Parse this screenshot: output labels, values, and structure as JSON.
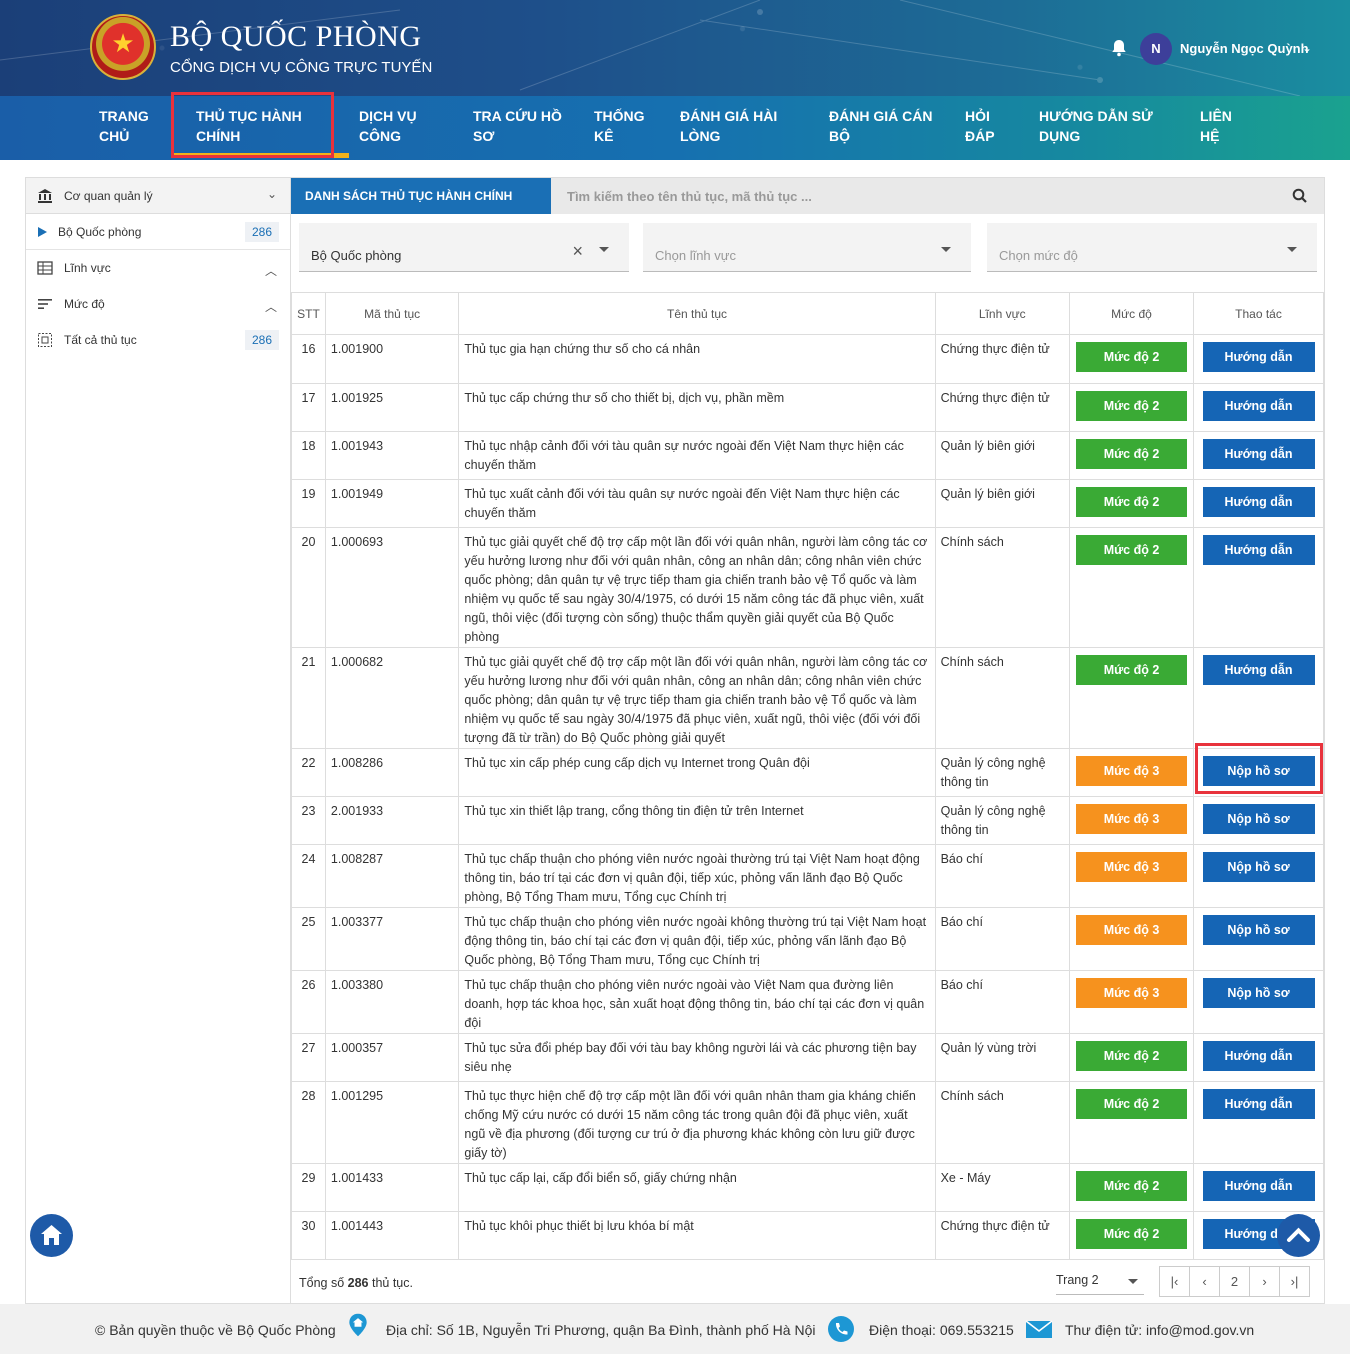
{
  "header": {
    "title": "BỘ QUỐC PHÒNG",
    "subtitle": "CỔNG DỊCH VỤ CÔNG TRỰC TUYẾN",
    "user_initial": "N",
    "user_name": "Nguyễn Ngọc Quỳnh"
  },
  "nav": [
    {
      "line1": "TRANG",
      "line2": "CHỦ"
    },
    {
      "line1": "THỦ TỤC HÀNH",
      "line2": "CHÍNH"
    },
    {
      "line1": "DỊCH VỤ",
      "line2": "CÔNG"
    },
    {
      "line1": "TRA CỨU HỒ",
      "line2": "SƠ"
    },
    {
      "line1": "THỐNG",
      "line2": "KÊ"
    },
    {
      "line1": "ĐÁNH GIÁ HÀI",
      "line2": "LÒNG"
    },
    {
      "line1": "ĐÁNH GIÁ CÁN",
      "line2": "BỘ"
    },
    {
      "line1": "HỎI",
      "line2": "ĐÁP"
    },
    {
      "line1": "HƯỚNG DẪN SỬ",
      "line2": "DỤNG"
    },
    {
      "line1": "LIÊN",
      "line2": "HỆ"
    }
  ],
  "sidebar": {
    "agency_header": "Cơ quan quản lý",
    "agency_item": "Bộ Quốc phòng",
    "agency_count": "286",
    "field_header": "Lĩnh vực",
    "level_header": "Mức độ",
    "all_label": "Tất cả thủ tục",
    "all_count": "286"
  },
  "main": {
    "tab_label": "DANH SÁCH THỦ TỤC HÀNH CHÍNH",
    "search_placeholder": "Tìm kiếm theo tên thủ tục, mã thủ tục ...",
    "filter_agency": "Bộ Quốc phòng",
    "filter_field_placeholder": "Chọn lĩnh vực",
    "filter_level_placeholder": "Chọn mức độ"
  },
  "table": {
    "headers": [
      "STT",
      "Mã thủ tục",
      "Tên thủ tục",
      "Lĩnh vực",
      "Mức độ",
      "Thao tác"
    ],
    "rows": [
      {
        "stt": "16",
        "code": "1.001900",
        "name": "Thủ tục gia hạn chứng thư số cho cá nhân",
        "field": "Chứng thực điện tử",
        "level": "Mức độ 2",
        "level_num": 2,
        "action": "Hướng dẫn"
      },
      {
        "stt": "17",
        "code": "1.001925",
        "name": "Thủ tục cấp chứng thư số cho thiết bị, dịch vụ, phần mềm",
        "field": "Chứng thực điện tử",
        "level": "Mức độ 2",
        "level_num": 2,
        "action": "Hướng dẫn"
      },
      {
        "stt": "18",
        "code": "1.001943",
        "name": "Thủ tục nhập cảnh đối với tàu quân sự nước ngoài đến Việt Nam thực hiện các chuyến thăm",
        "field": "Quản lý biên giới",
        "level": "Mức độ 2",
        "level_num": 2,
        "action": "Hướng dẫn"
      },
      {
        "stt": "19",
        "code": "1.001949",
        "name": "Thủ tục xuất cảnh đối với tàu quân sự nước ngoài đến Việt Nam thực hiện các chuyến thăm",
        "field": "Quản lý biên giới",
        "level": "Mức độ 2",
        "level_num": 2,
        "action": "Hướng dẫn"
      },
      {
        "stt": "20",
        "code": "1.000693",
        "name": "Thủ tục giải quyết chế độ trợ cấp một lần đối với quân nhân, người làm công tác cơ yếu hưởng lương như đối với quân nhân, công an nhân dân; công nhân viên chức quốc phòng; dân quân tự vệ trực tiếp tham gia chiến tranh bảo vệ Tổ quốc và làm nhiệm vụ quốc tế sau ngày 30/4/1975, có dưới 15 năm công tác đã phục viên, xuất ngũ, thôi việc (đối tượng còn sống) thuộc thẩm quyền giải quyết của Bộ Quốc phòng",
        "field": "Chính sách",
        "level": "Mức độ 2",
        "level_num": 2,
        "action": "Hướng dẫn"
      },
      {
        "stt": "21",
        "code": "1.000682",
        "name": "Thủ tục giải quyết chế độ trợ cấp một lần đối với quân nhân, người làm công tác cơ yếu hưởng lương như đối với quân nhân, công an nhân dân; công nhân viên chức quốc phòng; dân quân tự vệ trực tiếp tham gia chiến tranh bảo vệ Tổ quốc và làm nhiệm vụ quốc tế sau ngày 30/4/1975 đã phục viên, xuất ngũ, thôi việc (đối với đối tượng đã từ trần) do Bộ Quốc phòng giải quyết",
        "field": "Chính sách",
        "level": "Mức độ 2",
        "level_num": 2,
        "action": "Hướng dẫn"
      },
      {
        "stt": "22",
        "code": "1.008286",
        "name": "Thủ tục xin cấp phép cung cấp dịch vụ Internet trong Quân đội",
        "field": "Quản lý công nghệ thông tin",
        "level": "Mức độ 3",
        "level_num": 3,
        "action": "Nộp hồ sơ"
      },
      {
        "stt": "23",
        "code": "2.001933",
        "name": "Thủ tục xin thiết lập trang, cổng thông tin điện tử trên Internet",
        "field": "Quản lý công nghệ thông tin",
        "level": "Mức độ 3",
        "level_num": 3,
        "action": "Nộp hồ sơ"
      },
      {
        "stt": "24",
        "code": "1.008287",
        "name": "Thủ tục chấp thuận cho phóng viên nước ngoài thường trú tại Việt Nam hoạt động thông tin, báo trí tại các đơn vị quân đội, tiếp xúc, phỏng vấn lãnh đạo Bộ Quốc phòng, Bộ Tổng Tham mưu, Tổng cục Chính trị",
        "field": "Báo chí",
        "level": "Mức độ 3",
        "level_num": 3,
        "action": "Nộp hồ sơ"
      },
      {
        "stt": "25",
        "code": "1.003377",
        "name": "Thủ tục chấp thuận cho phóng viên nước ngoài không thường trú tại Việt Nam hoạt động thông tin, báo chí tại các đơn vị quân đội, tiếp xúc, phỏng vấn lãnh đạo Bộ Quốc phòng, Bộ Tổng Tham mưu, Tổng cục Chính trị",
        "field": "Báo chí",
        "level": "Mức độ 3",
        "level_num": 3,
        "action": "Nộp hồ sơ"
      },
      {
        "stt": "26",
        "code": "1.003380",
        "name": "Thủ tục chấp thuận cho phóng viên nước ngoài vào Việt Nam qua đường liên doanh, hợp tác khoa học, sản xuất hoạt động thông tin, báo chí tại các đơn vị quân đội",
        "field": "Báo chí",
        "level": "Mức độ 3",
        "level_num": 3,
        "action": "Nộp hồ sơ"
      },
      {
        "stt": "27",
        "code": "1.000357",
        "name": "Thủ tục sửa đổi phép bay đối với tàu bay không người lái và các phương tiện bay siêu nhẹ",
        "field": "Quản lý vùng trời",
        "level": "Mức độ 2",
        "level_num": 2,
        "action": "Hướng dẫn"
      },
      {
        "stt": "28",
        "code": "1.001295",
        "name": "Thủ tục thực hiện chế độ trợ cấp một lần đối với quân nhân tham gia kháng chiến chống Mỹ cứu nước có dưới 15 năm công tác trong quân đội đã phục viên, xuất ngũ về địa phương (đối tượng cư trú ở địa phương khác không còn lưu giữ được giấy tờ)",
        "field": "Chính sách",
        "level": "Mức độ 2",
        "level_num": 2,
        "action": "Hướng dẫn"
      },
      {
        "stt": "29",
        "code": "1.001433",
        "name": "Thủ tục cấp lại, cấp đổi biển số, giấy chứng nhận",
        "field": "Xe - Máy",
        "level": "Mức độ 2",
        "level_num": 2,
        "action": "Hướng dẫn"
      },
      {
        "stt": "30",
        "code": "1.001443",
        "name": "Thủ tục khôi phục thiết bị lưu khóa bí mật",
        "field": "Chứng thực điện tử",
        "level": "Mức độ 2",
        "level_num": 2,
        "action": "Hướng dẫn"
      }
    ]
  },
  "footer_list": {
    "total_prefix": "Tổng số ",
    "total_count": "286",
    "total_suffix": " thủ tục.",
    "page_select": "Trang 2",
    "pager": [
      "|‹",
      "‹",
      "2",
      "›",
      "›|"
    ]
  },
  "footer": {
    "copyright": "© Bản quyền thuộc về Bộ Quốc Phòng",
    "address": "Địa chỉ: Số 1B, Nguyễn Tri Phương, quận Ba Đình, thành phố Hà Nội",
    "phone": "Điện thoại: 069.553215",
    "email": "Thư điện tử: info@mod.gov.vn"
  },
  "colors": {
    "primary": "#1565b5",
    "level2": "#3aaa35",
    "level3": "#f6921e",
    "highlight": "#e8323c",
    "accent_underline": "#f3b21a"
  },
  "icons": [
    "bell-icon",
    "bank-icon",
    "grid-icon",
    "sort-icon",
    "list-icon",
    "search-icon",
    "home-icon",
    "arrow-up-icon",
    "location-icon",
    "phone-icon",
    "mail-icon"
  ]
}
